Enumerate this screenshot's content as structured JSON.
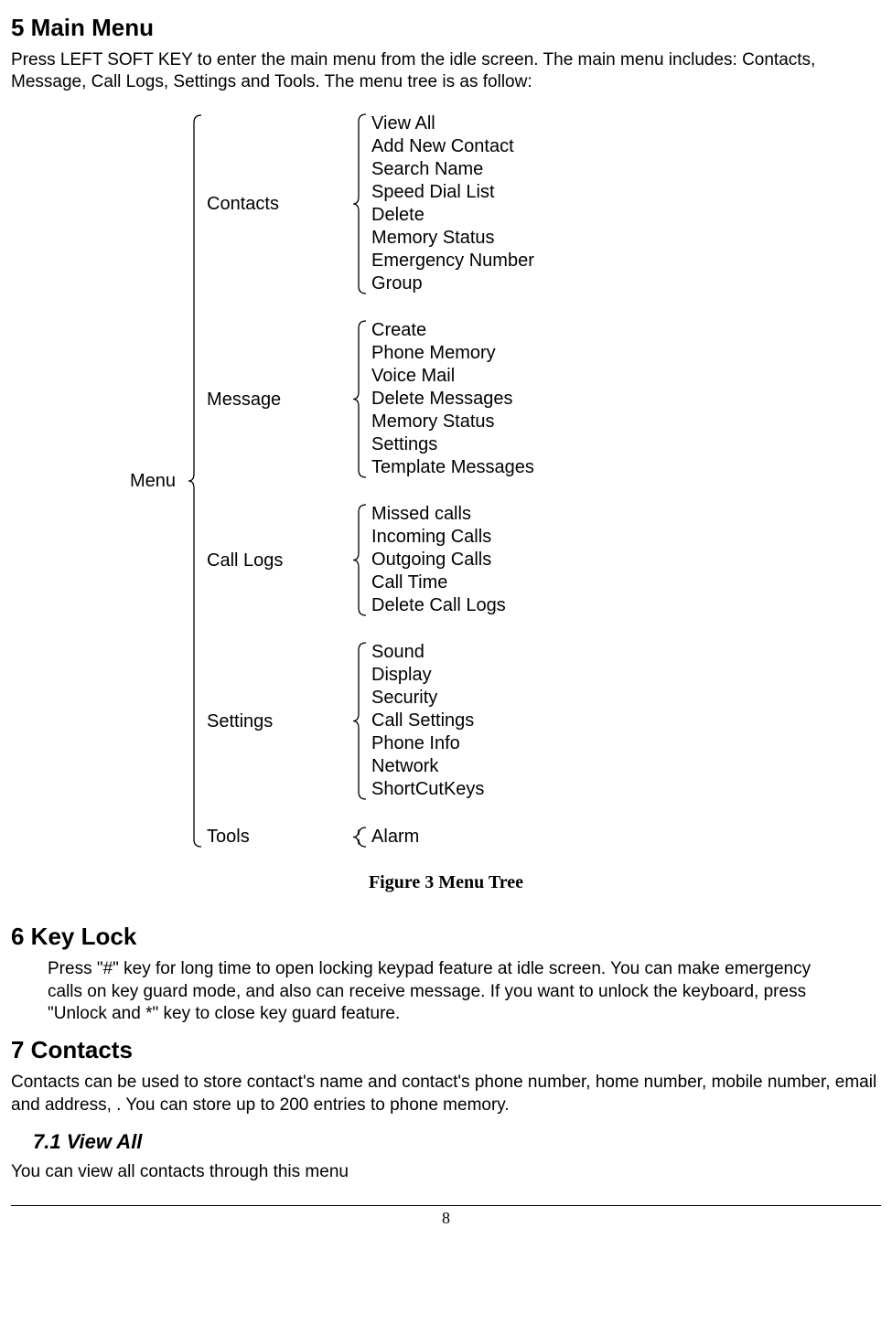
{
  "section5": {
    "heading": "5    Main Menu",
    "paragraph": "Press LEFT SOFT KEY to enter the main menu from the idle screen. The main menu includes: Contacts, Message, Call Logs, Settings and Tools. The menu tree is as follow:"
  },
  "menu_tree": {
    "root": "Menu",
    "groups": [
      {
        "label": "Contacts",
        "items": [
          "View  All",
          "Add  New Contact",
          "Search Name",
          "Speed Dial List",
          "Delete",
          "Memory Status",
          "Emergency Number",
          "Group"
        ]
      },
      {
        "label": "Message",
        "items": [
          "Create",
          "Phone Memory",
          "Voice Mail",
          "Delete Messages",
          "Memory Status",
          "Settings",
          "Template Messages"
        ]
      },
      {
        "label": "Call Logs",
        "items": [
          "Missed calls",
          "Incoming Calls",
          "Outgoing Calls",
          "Call Time",
          "Delete Call Logs"
        ]
      },
      {
        "label": "Settings",
        "items": [
          "Sound",
          "Display",
          "Security",
          "Call Settings",
          "Phone Info",
          "Network",
          "ShortCutKeys"
        ]
      },
      {
        "label": "Tools",
        "items": [
          "Alarm"
        ]
      }
    ],
    "figure_caption": "Figure 3 Menu Tree"
  },
  "section6": {
    "heading": "6    Key Lock",
    "paragraph": "Press \"#\" key for long time to open locking keypad feature at idle screen. You can make emergency calls on key guard mode, and also can receive message. If you want to unlock the keyboard, press \"Unlock and *\" key to close key guard feature."
  },
  "section7": {
    "heading": "7    Contacts",
    "paragraph": "Contacts can be used to store contact's name and contact's phone number, home number, mobile number, email and address, . You can store up to 200 entries to phone memory."
  },
  "section7_1": {
    "heading": "7.1    View All",
    "paragraph": "You can view all contacts through this menu"
  },
  "page_number": "8"
}
